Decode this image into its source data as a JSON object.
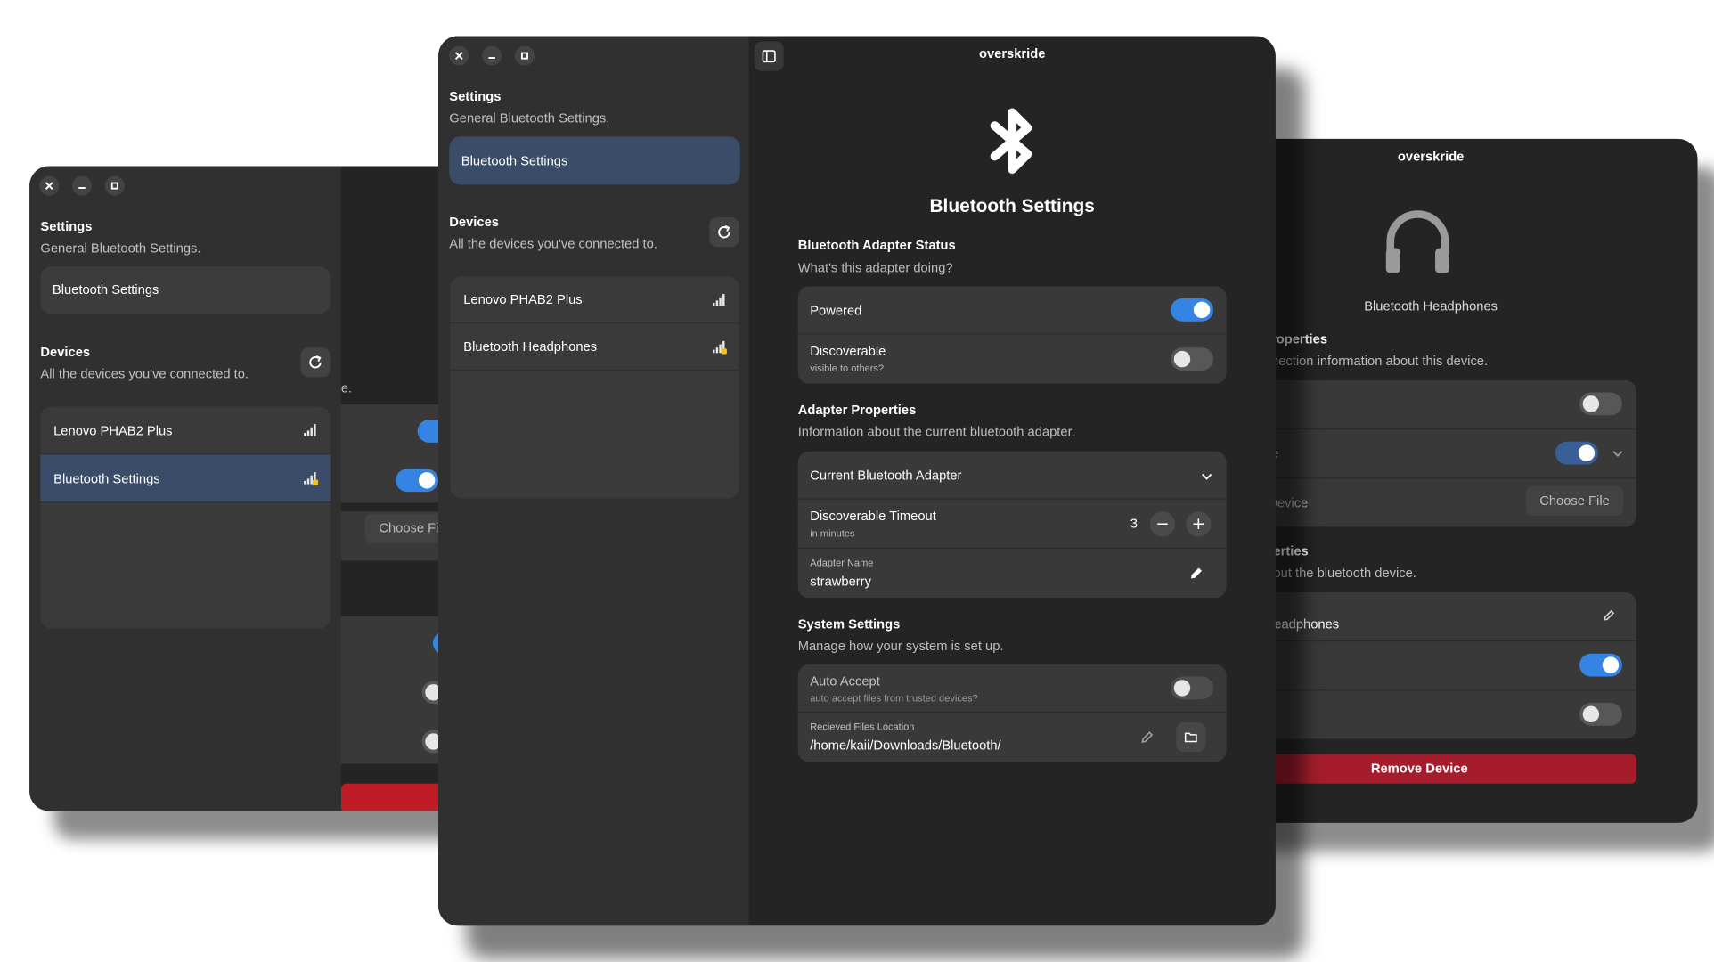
{
  "window": {
    "title": "overskride"
  },
  "sidebar": {
    "settings_title": "Settings",
    "settings_subtitle": "General Bluetooth Settings.",
    "bluetooth_settings_item": "Bluetooth Settings",
    "devices_title": "Devices",
    "devices_subtitle": "All the devices you've connected to.",
    "devices": [
      {
        "name": "Lenovo PHAB2 Plus",
        "signal_bars": 4,
        "locked": false
      },
      {
        "name": "Bluetooth Headphones",
        "signal_bars": 4,
        "locked": true
      }
    ],
    "left_window_devices": [
      {
        "name": "Lenovo PHAB2 Plus",
        "signal_bars": 4,
        "locked": false
      },
      {
        "name": "Bluetooth Settings",
        "signal_bars": 4,
        "locked": true
      }
    ]
  },
  "main": {
    "hero_icon": "bluetooth-icon",
    "title": "Bluetooth Settings",
    "adapter_status": {
      "title": "Bluetooth Adapter Status",
      "subtitle": "What's this adapter doing?",
      "powered_label": "Powered",
      "powered": true,
      "discoverable_label": "Discoverable",
      "discoverable_sub": "visible to others?",
      "discoverable": false
    },
    "adapter_properties": {
      "title": "Adapter Properties",
      "subtitle": "Information about the current bluetooth adapter.",
      "current_adapter_label": "Current Bluetooth Adapter",
      "timeout_label": "Discoverable Timeout",
      "timeout_sub": "in minutes",
      "timeout_value": "3",
      "minus": "−",
      "plus": "+",
      "name_label": "Adapter Name",
      "name_value": "strawberry"
    },
    "system_settings": {
      "title": "System Settings",
      "subtitle": "Manage how your system is set up.",
      "auto_accept_label": "Auto Accept",
      "auto_accept_sub": "auto accept files from trusted devices?",
      "auto_accept": false,
      "files_location_label": "Recieved Files Location",
      "files_location_value": "/home/kaii/Downloads/Bluetooth/"
    }
  },
  "right_window": {
    "title": "overskride",
    "device_icon": "headphones-icon",
    "device_name": "Bluetooth Headphones",
    "properties_title_fragment": "roperties",
    "properties_sub_fragment": "nection information about this device.",
    "row_fragment_1": "e",
    "row_fragment_2": "Device",
    "choose_file": "Choose File",
    "props2_title_fragment": "erties",
    "props2_sub_fragment": "out the bluetooth device.",
    "name_fragment": "leadphones",
    "remove_device": "Remove Device",
    "toggle_1": false,
    "toggle_2": true,
    "toggle_3": true,
    "toggle_4": false
  },
  "left_window": {
    "peek_text": "e.",
    "choose_fragment": "Choose Fi"
  },
  "colors": {
    "accent": "#3584e4",
    "selected": "#3a4c68",
    "destructive": "#c01c28",
    "window_bg": "#242424",
    "sidebar_bg": "#303030"
  }
}
